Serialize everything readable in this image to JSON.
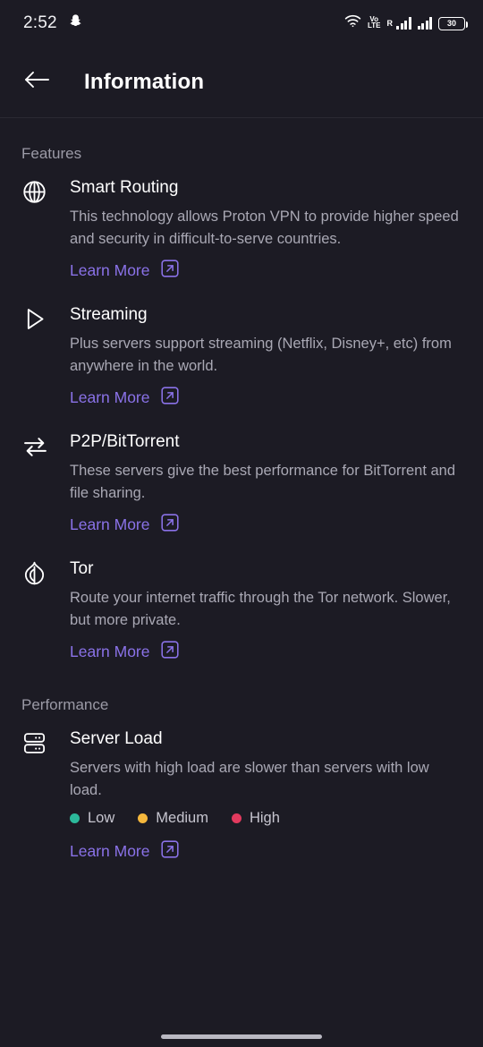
{
  "status_bar": {
    "time": "2:52",
    "app_icon": "snapchat-ghost-icon",
    "wifi_icon": "wifi-icon",
    "volte_top": "Vo",
    "volte_bottom": "LTE",
    "roaming": "R",
    "battery_level": "30"
  },
  "app_bar": {
    "back_icon": "arrow-left-icon",
    "title": "Information"
  },
  "sections": [
    {
      "label": "Features",
      "items": [
        {
          "icon": "globe-icon",
          "title": "Smart Routing",
          "description": "This technology allows Proton VPN to provide higher speed and security in difficult-to-serve countries.",
          "link_label": "Learn More",
          "link_icon": "external-link-icon"
        },
        {
          "icon": "play-icon",
          "title": "Streaming",
          "description": "Plus servers support streaming (Netflix, Disney+, etc) from anywhere in the world.",
          "link_label": "Learn More",
          "link_icon": "external-link-icon"
        },
        {
          "icon": "swap-arrows-icon",
          "title": "P2P/BitTorrent",
          "description": "These servers give the best performance for BitTorrent and file sharing.",
          "link_label": "Learn More",
          "link_icon": "external-link-icon"
        },
        {
          "icon": "onion-icon",
          "title": "Tor",
          "description": "Route your internet traffic through the Tor network. Slower, but more private.",
          "link_label": "Learn More",
          "link_icon": "external-link-icon"
        }
      ]
    },
    {
      "label": "Performance",
      "items": [
        {
          "icon": "server-icon",
          "title": "Server Load",
          "description": "Servers with high load are slower than servers with low load.",
          "link_label": "Learn More",
          "link_icon": "external-link-icon",
          "legend": [
            {
              "label": "Low",
              "color": "#2cb99b"
            },
            {
              "label": "Medium",
              "color": "#f5b73c"
            },
            {
              "label": "High",
              "color": "#e23a5e"
            }
          ]
        }
      ]
    }
  ],
  "theme": {
    "background": "#1c1b24",
    "accent_purple": "#8a72e8",
    "title_color": "#ffffff",
    "body_color": "#a9a8b4",
    "section_label_color": "#9b9aa6"
  },
  "home_indicator": "gesture-home-bar"
}
